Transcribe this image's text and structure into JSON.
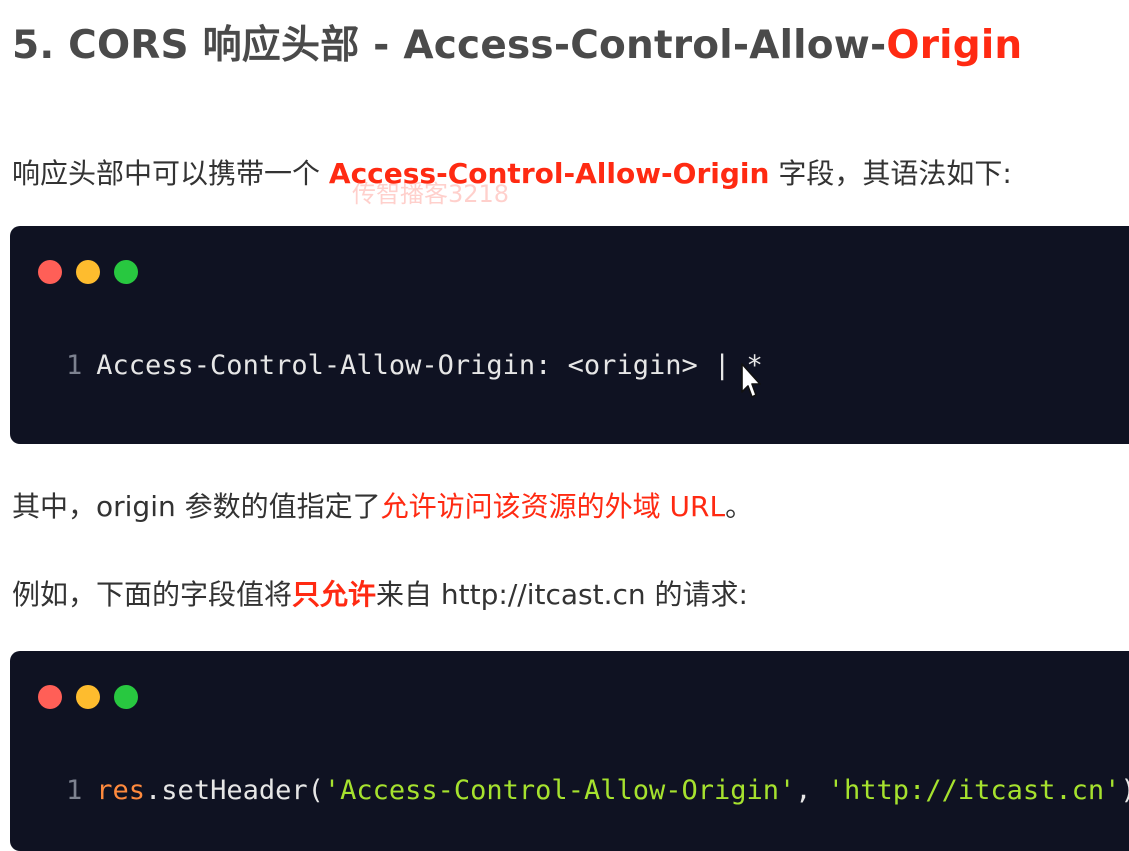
{
  "heading": {
    "prefix": "5. CORS 响应头部 - Access-Control-Allow-",
    "highlight": "Origin"
  },
  "para1": {
    "before": "响应头部中可以携带一个 ",
    "highlight": "Access-Control-Allow-Origin",
    "after": " 字段，其语法如下:"
  },
  "watermark": "传智播客3218",
  "window_dots": {
    "red": "#ff5f57",
    "yellow": "#febc2e",
    "green": "#28c840"
  },
  "code1": {
    "line_number": "1",
    "text": "Access-Control-Allow-Origin: <origin> | *"
  },
  "para2": {
    "before": "其中，origin 参数的值指定了",
    "highlight": "允许访问该资源的外域 URL",
    "after": "。"
  },
  "para3": {
    "before": "例如，下面的字段值将",
    "highlight": "只允许",
    "after": "来自 http://itcast.cn 的请求:"
  },
  "code2": {
    "line_number": "1",
    "obj": "res",
    "method": ".setHeader(",
    "arg1": "'Access-Control-Allow-Origin'",
    "sep": ", ",
    "arg2": "'http://itcast.cn'",
    "close": ")"
  },
  "colors": {
    "accent_red": "#ff2a12",
    "code_bg": "#0f1222",
    "string_green": "#a6e22e",
    "object_orange": "#ff8a3d"
  }
}
